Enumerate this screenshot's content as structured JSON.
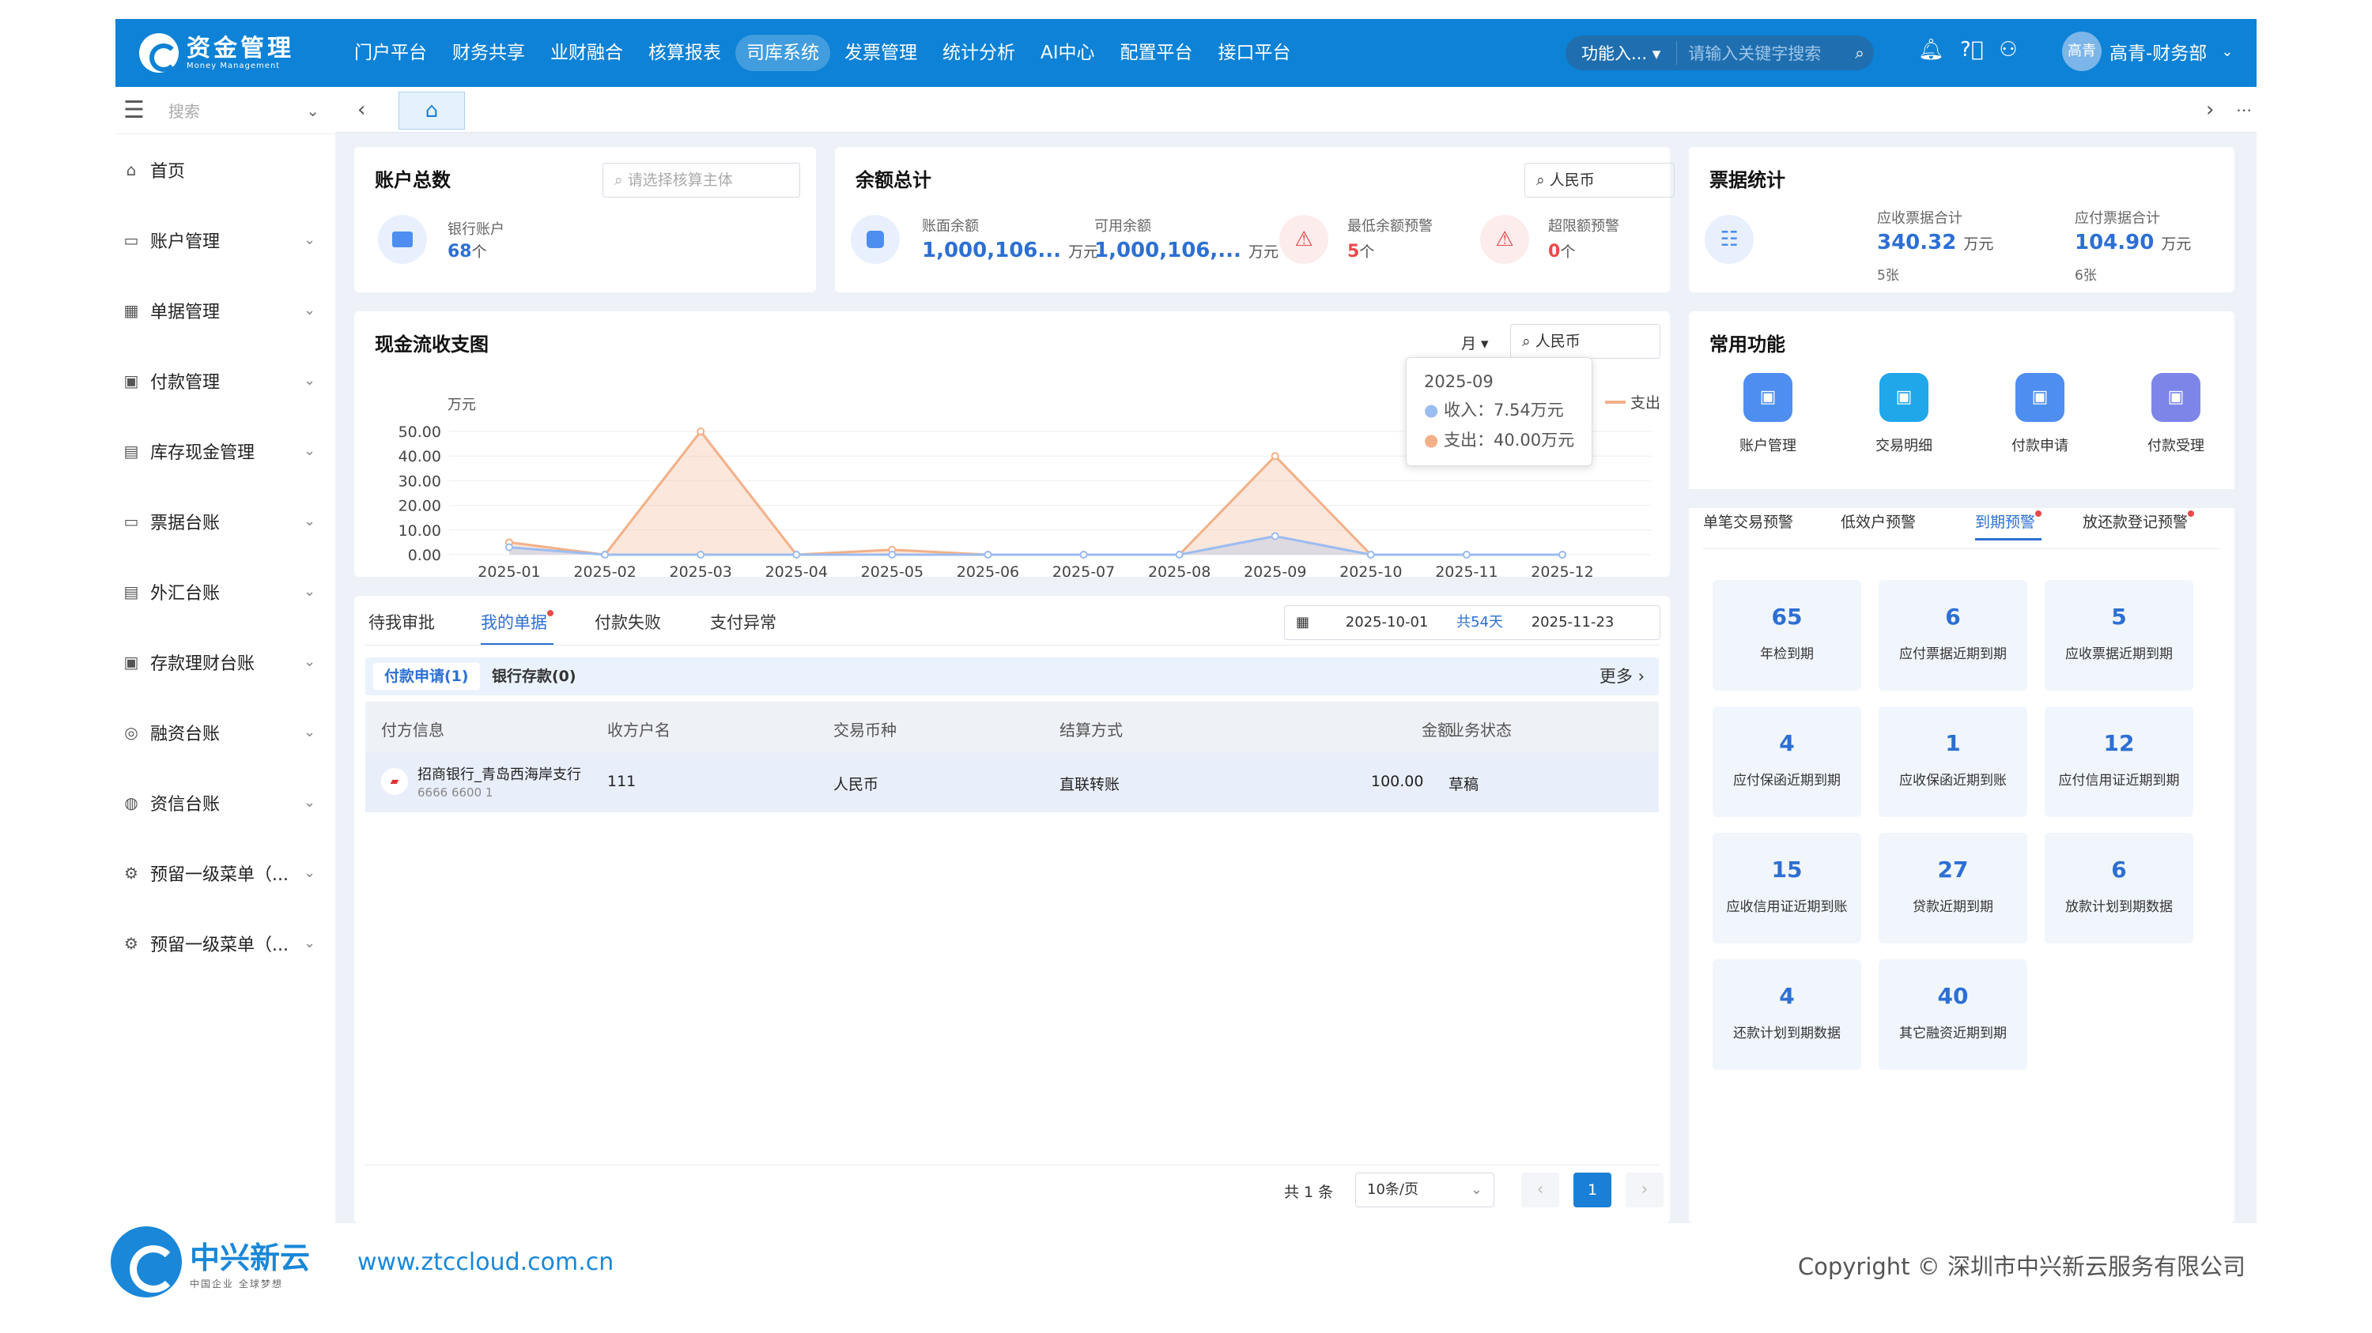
{
  "app": {
    "name": "资金管理",
    "subname": "Money Management"
  },
  "nav": [
    "门户平台",
    "财务共享",
    "业财融合",
    "核算报表",
    "司库系统",
    "发票管理",
    "统计分析",
    "AI中心",
    "配置平台",
    "接口平台"
  ],
  "nav_active": 4,
  "topsearch": {
    "func_label": "功能入...",
    "placeholder": "请输入关键字搜索"
  },
  "user": {
    "avatar": "高青",
    "name": "高青-财务部"
  },
  "side": {
    "search": "搜索",
    "items": [
      {
        "icon": "home-icon",
        "glyph": "⌂",
        "label": "首页"
      },
      {
        "icon": "account-icon",
        "glyph": "▭",
        "label": "账户管理"
      },
      {
        "icon": "bill-icon",
        "glyph": "▦",
        "label": "单据管理"
      },
      {
        "icon": "payment-icon",
        "glyph": "▣",
        "label": "付款管理"
      },
      {
        "icon": "cash-icon",
        "glyph": "▤",
        "label": "库存现金管理"
      },
      {
        "icon": "ledger-icon",
        "glyph": "▭",
        "label": "票据台账"
      },
      {
        "icon": "fx-icon",
        "glyph": "▤",
        "label": "外汇台账"
      },
      {
        "icon": "deposit-icon",
        "glyph": "▣",
        "label": "存款理财台账"
      },
      {
        "icon": "finance-icon",
        "glyph": "◎",
        "label": "融资台账"
      },
      {
        "icon": "credit-icon",
        "glyph": "◍",
        "label": "资信台账"
      },
      {
        "icon": "gear-icon",
        "glyph": "⚙",
        "label": "预留一级菜单（..."
      },
      {
        "icon": "gear-icon",
        "glyph": "⚙",
        "label": "预留一级菜单（..."
      }
    ]
  },
  "accounts": {
    "title": "账户总数",
    "select_placeholder": "请选择核算主体",
    "label": "银行账户",
    "value": "68",
    "unit": "个"
  },
  "balance": {
    "title": "余额总计",
    "currency": "人民币",
    "book_label": "账面余额",
    "book_value": "1,000,106...",
    "book_unit": "万元",
    "avail_label": "可用余额",
    "avail_value": "1,000,106,...",
    "avail_unit": "万元",
    "min_label": "最低余额预警",
    "min_value": "5",
    "min_unit": "个",
    "over_label": "超限额预警",
    "over_value": "0",
    "over_unit": "个"
  },
  "bills": {
    "title": "票据统计",
    "recv_label": "应收票据合计",
    "recv_value": "340.32",
    "recv_unit": "万元",
    "recv_count": "5张",
    "pay_label": "应付票据合计",
    "pay_value": "104.90",
    "pay_unit": "万元",
    "pay_count": "6张"
  },
  "cashflow": {
    "title": "现金流收支图",
    "period_suffix": "月",
    "currency": "人民币",
    "unit": "万元",
    "tooltip": {
      "month": "2025-09",
      "income": "收入：7.54万元",
      "expense": "支出：40.00万元"
    }
  },
  "chart_data": {
    "type": "area",
    "title": "现金流收支图",
    "ylabel": "万元",
    "ylim": [
      0,
      50
    ],
    "yticks": [
      "50.00",
      "40.00",
      "30.00",
      "20.00",
      "10.00",
      "0.00"
    ],
    "categories": [
      "2025-01",
      "2025-02",
      "2025-03",
      "2025-04",
      "2025-05",
      "2025-06",
      "2025-07",
      "2025-08",
      "2025-09",
      "2025-10",
      "2025-11",
      "2025-12"
    ],
    "series": [
      {
        "name": "收入",
        "color": "#9bbcf0",
        "values": [
          3,
          0,
          0,
          0,
          0,
          0,
          0,
          0,
          7.54,
          0,
          0,
          0
        ]
      },
      {
        "name": "支出",
        "color": "#f3b088",
        "values": [
          5,
          0,
          50,
          0,
          2,
          0,
          0,
          0,
          40,
          0,
          0,
          0
        ]
      }
    ],
    "legend": "top-right",
    "grid": true
  },
  "quick": {
    "title": "常用功能",
    "items": [
      {
        "label": "账户管理",
        "color": "#4e8ef0",
        "icon": "account-manage-icon"
      },
      {
        "label": "交易明细",
        "color": "#1fa7ea",
        "icon": "transaction-icon"
      },
      {
        "label": "付款申请",
        "color": "#4e8ef0",
        "icon": "pay-apply-icon"
      },
      {
        "label": "付款受理",
        "color": "#7d86e8",
        "icon": "pay-accept-icon"
      }
    ]
  },
  "warn": {
    "tabs": [
      "单笔交易预警",
      "低效户预警",
      "到期预警",
      "放还款登记预警"
    ],
    "active": 2,
    "tiles": [
      {
        "n": "65",
        "t": "年检到期"
      },
      {
        "n": "6",
        "t": "应付票据近期到期"
      },
      {
        "n": "5",
        "t": "应收票据近期到期"
      },
      {
        "n": "4",
        "t": "应付保函近期到期"
      },
      {
        "n": "1",
        "t": "应收保函近期到账"
      },
      {
        "n": "12",
        "t": "应付信用证近期到期"
      },
      {
        "n": "15",
        "t": "应收信用证近期到账"
      },
      {
        "n": "27",
        "t": "贷款近期到期"
      },
      {
        "n": "6",
        "t": "放款计划到期数据"
      },
      {
        "n": "4",
        "t": "还款计划到期数据"
      },
      {
        "n": "40",
        "t": "其它融资近期到期"
      }
    ]
  },
  "bottom": {
    "tabs": [
      "待我审批",
      "我的单据",
      "付款失败",
      "支付异常"
    ],
    "active": 1,
    "date_start": "2025-10-01",
    "date_mid": "共54天",
    "date_end": "2025-11-23",
    "subtabs": [
      "付款申请(1)",
      "银行存款(0)"
    ],
    "more": "更多",
    "headers": [
      "付方信息",
      "收方户名",
      "交易币种",
      "结算方式",
      "金额",
      "业务状态"
    ],
    "row": {
      "payer": "招商银行_青岛西海岸支行",
      "payer_acct": "6666 6600 1",
      "payee": "111",
      "currency": "人民币",
      "method": "直联转账",
      "amount": "100.00",
      "status": "草稿"
    },
    "total": "共 1 条",
    "page_size": "10条/页",
    "page": "1"
  },
  "footer": {
    "brand": "中兴新云",
    "slogan": "中国企业 全球梦想",
    "site": "www.ztccloud.com.cn",
    "copyright": "Copyright © 深圳市中兴新云服务有限公司"
  }
}
